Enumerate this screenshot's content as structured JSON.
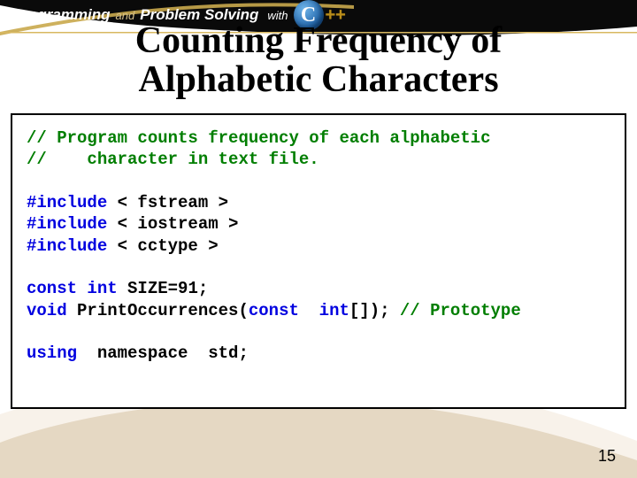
{
  "header": {
    "programming": "Programming",
    "and": "and",
    "problem_solving": "Problem Solving",
    "with": "with",
    "logo_c": "C",
    "logo_plus": "++"
  },
  "title_line1": "Counting Frequency of",
  "title_line2": "Alphabetic Characters",
  "code": {
    "c1": "// Program counts frequency of each alphabetic",
    "c2": "//    character in text file.",
    "inc1a": "#include",
    "inc1b": " < fstream >",
    "inc2a": "#include",
    "inc2b": " < iostream >",
    "inc3a": "#include",
    "inc3b": " < cctype >",
    "l1a": "const int ",
    "l1b": "SIZE",
    "l1c": "=91;",
    "l2a": "void ",
    "l2b": "PrintOccurrences",
    "l2c": "(",
    "l2d": "const  int",
    "l2e": "[]); ",
    "l2f": "// Prototype",
    "l3a": "using",
    "l3b": "  namespace  std;"
  },
  "page_number": "15"
}
